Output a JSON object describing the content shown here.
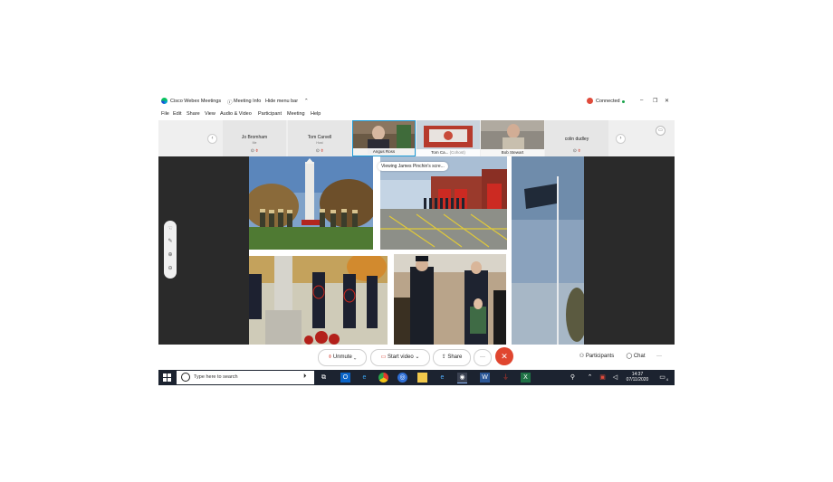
{
  "titlebar": {
    "app_title": "Cisco Webex Meetings",
    "meeting_info": "Meeting Info",
    "hide_menu": "Hide menu bar",
    "status": "Connected"
  },
  "menu": [
    "File",
    "Edit",
    "Share",
    "View",
    "Audio & Video",
    "Participant",
    "Meeting",
    "Help"
  ],
  "participants": {
    "jo": {
      "name": "Jo Bromham",
      "role": "Me"
    },
    "tom": {
      "name": "Tom Carvell",
      "role": "Host"
    },
    "angus": {
      "name": "Angus Ross"
    },
    "tomca": {
      "name": "Tom Ca...",
      "extra": "(Cohost)"
    },
    "bob": {
      "name": "Bob Stewart"
    },
    "colin": {
      "name": "colin dudley"
    }
  },
  "share": {
    "viewing": "Viewing James Pinchin's scre..."
  },
  "controls": {
    "unmute": "Unmute",
    "start_video": "Start video",
    "share": "Share",
    "participants": "Participants",
    "chat": "Chat"
  },
  "taskbar": {
    "search_placeholder": "Type here to search",
    "time": "14:37",
    "date": "07/11/2020",
    "notifications": "4"
  },
  "colors": {
    "end_call": "#e0462f",
    "connected": "#e04b3b",
    "taskbar": "#1c2330"
  }
}
